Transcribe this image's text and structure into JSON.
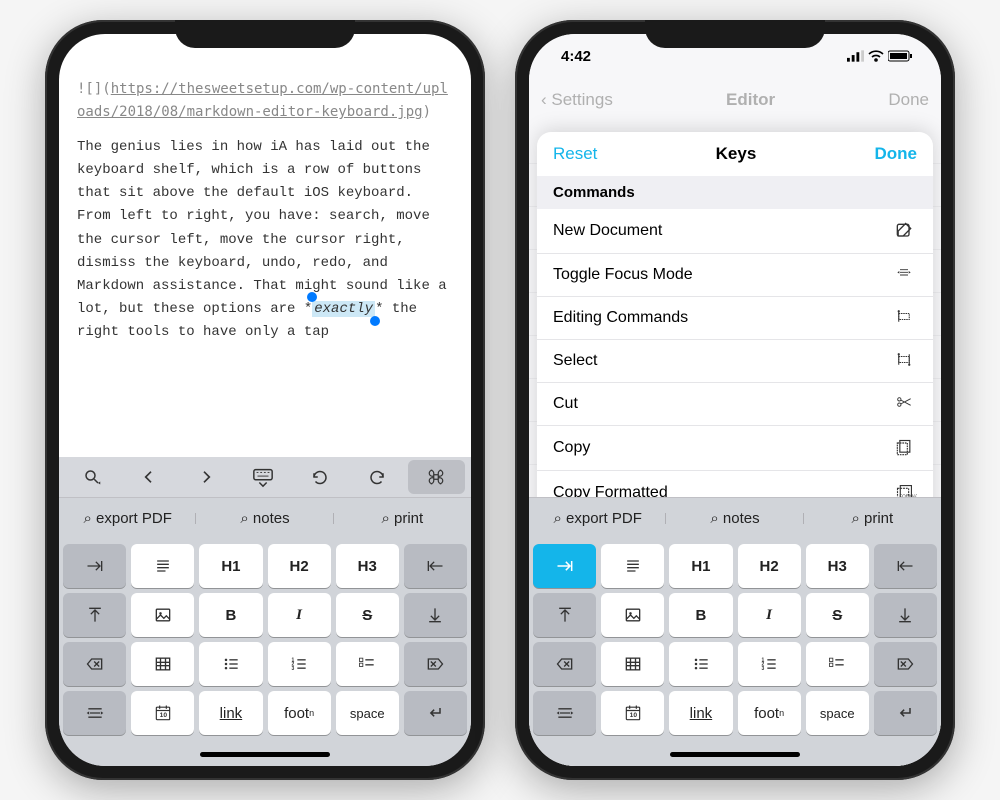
{
  "left_phone": {
    "image_syntax_prefix": "![](",
    "image_url": "https://thesweetsetup.com/wp-content/uploads/2018/08/markdown-editor-keyboard.jpg",
    "image_syntax_suffix": ")",
    "paragraph_pre": "The genius lies in how iA has laid out the keyboard shelf, which is a row of buttons that sit above the default iOS keyboard. From left to right, you have: search, move the cursor left, move the cursor right, dismiss the keyboard, undo, redo, and Markdown assistance. That might sound like a lot, but these options are *",
    "highlight_word": "exactly",
    "paragraph_post": "* the right tools to have only a tap"
  },
  "toolbar_icons": {
    "search": "search-icon",
    "left": "chevron-left-icon",
    "right": "chevron-right-icon",
    "keyboard": "keyboard-dismiss-icon",
    "undo": "undo-icon",
    "redo": "redo-icon",
    "command": "command-icon"
  },
  "suggestions": {
    "s1": "⌕ export PDF",
    "s2": "⌕ notes",
    "s3": "⌕ print"
  },
  "kb_labels": {
    "h1": "H1",
    "h2": "H2",
    "h3": "H3",
    "bold": "B",
    "italic": "I",
    "strike": "S",
    "link": "link",
    "foot": "foot",
    "foot_sup": "n",
    "space": "space",
    "date": "10"
  },
  "right_phone": {
    "status_time": "4:42",
    "nav_back": "Settings",
    "nav_title": "Editor",
    "nav_done": "Done",
    "sheet": {
      "reset": "Reset",
      "title": "Keys",
      "done": "Done",
      "section": "Commands",
      "commands": {
        "c1": "New Document",
        "c2": "Toggle Focus Mode",
        "c3": "Editing Commands",
        "c4": "Select",
        "c5": "Cut",
        "c6": "Copy",
        "c7": "Copy Formatted"
      }
    }
  }
}
